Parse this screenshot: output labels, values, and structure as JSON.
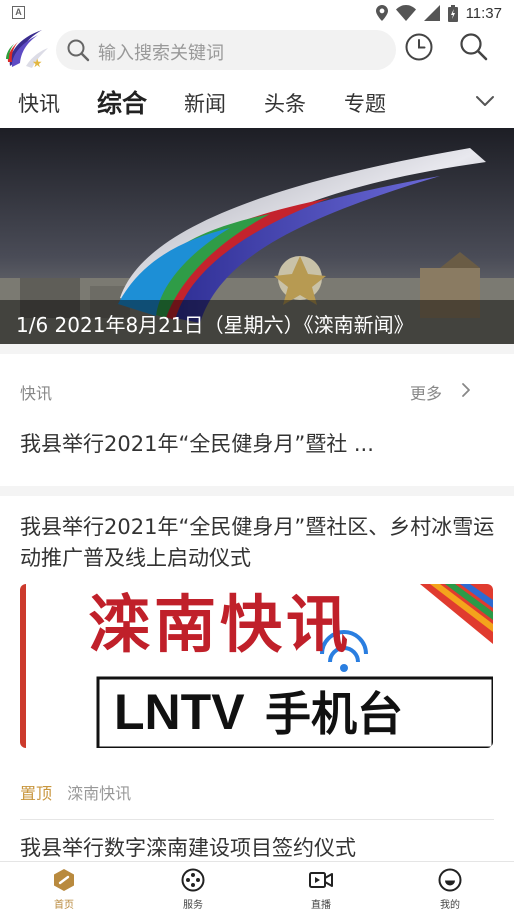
{
  "status_bar": {
    "time": "11:37",
    "app_indicator": "A"
  },
  "header": {
    "search_placeholder": "输入搜索关键词",
    "logo_icon": "ribbon-logo-icon",
    "history_icon": "clock-icon",
    "search_icon": "search-icon"
  },
  "tabs": [
    {
      "label": "快讯",
      "active": false
    },
    {
      "label": "综合",
      "active": true
    },
    {
      "label": "新闻",
      "active": false
    },
    {
      "label": "头条",
      "active": false
    },
    {
      "label": "专题",
      "active": false
    }
  ],
  "banner": {
    "caption": "1/6 2021年8月21日（星期六）《滦南新闻》"
  },
  "flash": {
    "label": "快讯",
    "more_label": "更多",
    "item": "我县举行2021年“全民健身月”暨社 ..."
  },
  "article": {
    "title": "我县举行2021年“全民健身月”暨社区、乡村冰雪运动推广普及线上启动仪式",
    "cover_title": "滦南快讯",
    "cover_subtitle_letters": "LNTV",
    "cover_subtitle_rest": "手机台",
    "pin_label": "置顶",
    "source": "滦南快讯"
  },
  "article2": {
    "title": "我县举行数字滦南建设项目签约仪式"
  },
  "bottom_nav": [
    {
      "label": "首页",
      "icon": "home-icon",
      "active": true
    },
    {
      "label": "服务",
      "icon": "service-icon",
      "active": false
    },
    {
      "label": "直播",
      "icon": "live-video-icon",
      "active": false
    },
    {
      "label": "我的",
      "icon": "profile-icon",
      "active": false
    }
  ],
  "colors": {
    "accent": "#b98a3e",
    "pin": "#c8963e",
    "cover_red": "#c0202a"
  }
}
